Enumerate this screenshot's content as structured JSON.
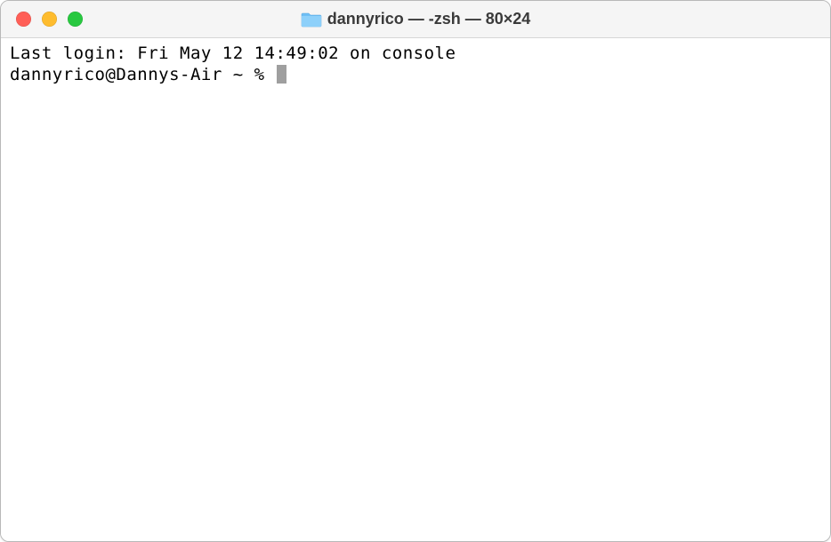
{
  "titlebar": {
    "title": "dannyrico — -zsh — 80×24",
    "icon": "folder-icon"
  },
  "terminal": {
    "last_login_line": "Last login: Fri May 12 14:49:02 on console",
    "prompt_line": "dannyrico@Dannys-Air ~ % "
  }
}
